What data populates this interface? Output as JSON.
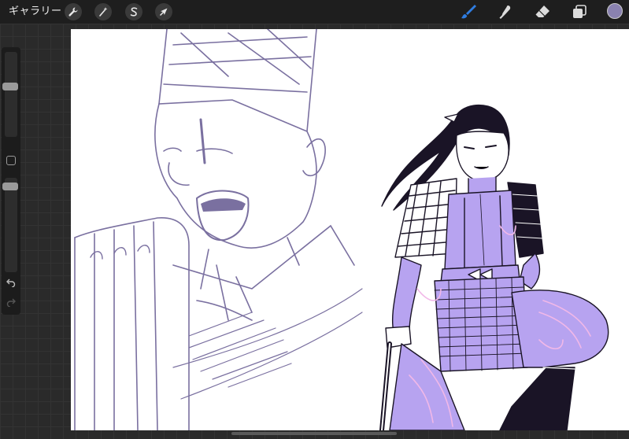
{
  "app": {
    "gallery_label": "ギャラリー"
  },
  "toolbar_left": {
    "actions_icon": "wrench-icon",
    "adjustments_icon": "magic-wand-icon",
    "selection_icon": "selection-s-icon",
    "transform_icon": "arrow-cursor-icon"
  },
  "toolbar_right": {
    "brush_icon": "brush-icon",
    "smudge_icon": "smudge-finger-icon",
    "eraser_icon": "eraser-icon",
    "layers_icon": "layers-icon",
    "active_color": "#8a82b0",
    "accent_color": "#2f7de1"
  },
  "sidebar": {
    "brush_size_level": 0.6,
    "opacity_level": 0.95
  },
  "canvas": {
    "line_color": "#7a70a0",
    "fill_color": "#b7a3f0",
    "pattern_color": "#f1b8e8"
  }
}
